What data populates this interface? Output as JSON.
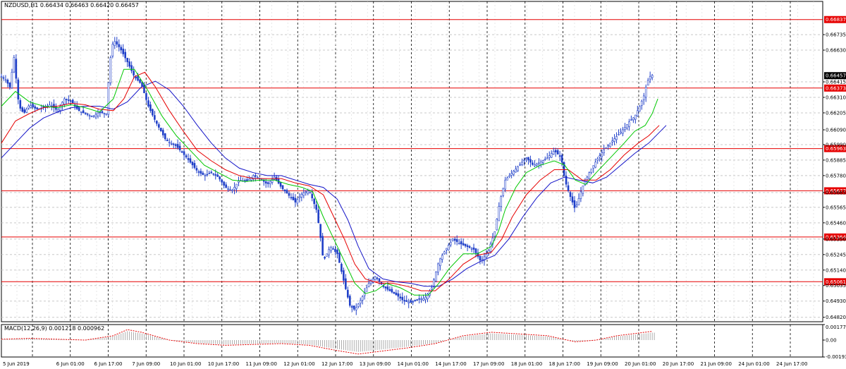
{
  "header": {
    "title": "NZDUSD,H1 0.66434 0.66463 0.66420 0.66457"
  },
  "indicator": {
    "label": "MACD(12,26,9) 0.001218 0.000962"
  },
  "colors": {
    "candle": "#1f3fc8",
    "ma_fast": "#00c800",
    "ma_mid": "#e60000",
    "ma_slow": "#1414c8",
    "level_line": "#e60000",
    "current_price_bg": "#000000"
  },
  "chart_data": [
    {
      "type": "candlestick",
      "symbol": "NZDUSD",
      "timeframe": "H1",
      "grid": true,
      "y_ticks": [
        "0.66735",
        "0.66630",
        "0.66415",
        "0.66310",
        "0.66205",
        "0.66090",
        "0.65990",
        "0.65885",
        "0.65780",
        "0.65665",
        "0.65565",
        "0.65460",
        "0.65350",
        "0.65245",
        "0.65140",
        "0.65035",
        "0.64930",
        "0.64820"
      ],
      "current_price": "0.66457",
      "levels": [
        "0.66837",
        "0.66373",
        "0.65963",
        "0.65677",
        "0.65364",
        "0.65061"
      ],
      "x_ticks": [
        "5 Jun 2019",
        "6 Jun 01:00",
        "6 Jun 17:00",
        "7 Jun 09:00",
        "10 Jun 01:00",
        "10 Jun 17:00",
        "11 Jun 09:00",
        "12 Jun 01:00",
        "12 Jun 17:00",
        "13 Jun 09:00",
        "14 Jun 01:00",
        "14 Jun 17:00",
        "17 Jun 09:00",
        "18 Jun 01:00",
        "18 Jun 17:00",
        "19 Jun 09:00",
        "20 Jun 01:00",
        "20 Jun 17:00",
        "21 Jun 09:00",
        "24 Jun 01:00",
        "24 Jun 17:00"
      ],
      "ylim": [
        0.6479,
        0.6696
      ],
      "close_path": [
        [
          0,
          0.6645
        ],
        [
          6,
          0.6643
        ],
        [
          12,
          0.6638
        ],
        [
          18,
          0.6658
        ],
        [
          25,
          0.6625
        ],
        [
          32,
          0.662
        ],
        [
          40,
          0.6626
        ],
        [
          50,
          0.6623
        ],
        [
          60,
          0.6624
        ],
        [
          70,
          0.6626
        ],
        [
          80,
          0.6622
        ],
        [
          90,
          0.663
        ],
        [
          100,
          0.6628
        ],
        [
          110,
          0.6622
        ],
        [
          120,
          0.662
        ],
        [
          130,
          0.6618
        ],
        [
          140,
          0.6621
        ],
        [
          150,
          0.662
        ],
        [
          155,
          0.6655
        ],
        [
          160,
          0.667
        ],
        [
          170,
          0.6664
        ],
        [
          180,
          0.6655
        ],
        [
          190,
          0.6645
        ],
        [
          200,
          0.664
        ],
        [
          210,
          0.6625
        ],
        [
          220,
          0.6615
        ],
        [
          235,
          0.6602
        ],
        [
          250,
          0.6598
        ],
        [
          265,
          0.659
        ],
        [
          280,
          0.6581
        ],
        [
          290,
          0.6578
        ],
        [
          300,
          0.658
        ],
        [
          310,
          0.6577
        ],
        [
          320,
          0.657
        ],
        [
          330,
          0.6568
        ],
        [
          340,
          0.6575
        ],
        [
          350,
          0.6574
        ],
        [
          360,
          0.6578
        ],
        [
          370,
          0.6576
        ],
        [
          380,
          0.6572
        ],
        [
          390,
          0.6577
        ],
        [
          400,
          0.657
        ],
        [
          410,
          0.6565
        ],
        [
          420,
          0.656
        ],
        [
          430,
          0.6566
        ],
        [
          440,
          0.6568
        ],
        [
          450,
          0.6555
        ],
        [
          455,
          0.654
        ],
        [
          460,
          0.652
        ],
        [
          470,
          0.653
        ],
        [
          480,
          0.6525
        ],
        [
          490,
          0.6505
        ],
        [
          498,
          0.649
        ],
        [
          505,
          0.6487
        ],
        [
          515,
          0.6495
        ],
        [
          525,
          0.6505
        ],
        [
          535,
          0.651
        ],
        [
          545,
          0.6503
        ],
        [
          555,
          0.65
        ],
        [
          565,
          0.6497
        ],
        [
          575,
          0.6493
        ],
        [
          585,
          0.6492
        ],
        [
          595,
          0.6494
        ],
        [
          605,
          0.6495
        ],
        [
          615,
          0.6502
        ],
        [
          625,
          0.652
        ],
        [
          635,
          0.6528
        ],
        [
          645,
          0.6535
        ],
        [
          655,
          0.6532
        ],
        [
          665,
          0.653
        ],
        [
          675,
          0.6528
        ],
        [
          685,
          0.652
        ],
        [
          695,
          0.6526
        ],
        [
          705,
          0.654
        ],
        [
          712,
          0.656
        ],
        [
          720,
          0.6575
        ],
        [
          730,
          0.658
        ],
        [
          740,
          0.6585
        ],
        [
          750,
          0.659
        ],
        [
          760,
          0.6585
        ],
        [
          770,
          0.6587
        ],
        [
          780,
          0.659
        ],
        [
          790,
          0.6595
        ],
        [
          800,
          0.659
        ],
        [
          805,
          0.6575
        ],
        [
          812,
          0.6565
        ],
        [
          820,
          0.6555
        ],
        [
          830,
          0.657
        ],
        [
          840,
          0.658
        ],
        [
          850,
          0.6588
        ],
        [
          860,
          0.6595
        ],
        [
          870,
          0.66
        ],
        [
          880,
          0.6605
        ],
        [
          890,
          0.661
        ],
        [
          898,
          0.6615
        ],
        [
          905,
          0.6618
        ],
        [
          912,
          0.6625
        ],
        [
          918,
          0.6632
        ],
        [
          922,
          0.664
        ],
        [
          926,
          0.6645
        ],
        [
          930,
          0.6646
        ]
      ],
      "ma_fast_path": [
        [
          0,
          0.6625
        ],
        [
          20,
          0.6635
        ],
        [
          40,
          0.6628
        ],
        [
          60,
          0.6625
        ],
        [
          80,
          0.6624
        ],
        [
          100,
          0.6626
        ],
        [
          120,
          0.6624
        ],
        [
          140,
          0.6621
        ],
        [
          160,
          0.663
        ],
        [
          175,
          0.665
        ],
        [
          190,
          0.665
        ],
        [
          210,
          0.6635
        ],
        [
          230,
          0.6618
        ],
        [
          250,
          0.6605
        ],
        [
          270,
          0.6595
        ],
        [
          290,
          0.6585
        ],
        [
          310,
          0.658
        ],
        [
          330,
          0.6575
        ],
        [
          350,
          0.6574
        ],
        [
          370,
          0.6575
        ],
        [
          390,
          0.6575
        ],
        [
          410,
          0.6572
        ],
        [
          430,
          0.657
        ],
        [
          445,
          0.6567
        ],
        [
          460,
          0.655
        ],
        [
          475,
          0.6535
        ],
        [
          490,
          0.652
        ],
        [
          505,
          0.6505
        ],
        [
          520,
          0.6498
        ],
        [
          535,
          0.65
        ],
        [
          550,
          0.6505
        ],
        [
          570,
          0.6502
        ],
        [
          590,
          0.6497
        ],
        [
          610,
          0.6497
        ],
        [
          625,
          0.6505
        ],
        [
          640,
          0.6515
        ],
        [
          660,
          0.6525
        ],
        [
          680,
          0.6525
        ],
        [
          700,
          0.653
        ],
        [
          710,
          0.654
        ],
        [
          720,
          0.6555
        ],
        [
          735,
          0.657
        ],
        [
          750,
          0.658
        ],
        [
          770,
          0.6585
        ],
        [
          790,
          0.6588
        ],
        [
          805,
          0.6585
        ],
        [
          820,
          0.6575
        ],
        [
          835,
          0.6572
        ],
        [
          850,
          0.658
        ],
        [
          870,
          0.659
        ],
        [
          890,
          0.66
        ],
        [
          905,
          0.6608
        ],
        [
          920,
          0.6612
        ],
        [
          930,
          0.662
        ],
        [
          938,
          0.663
        ]
      ],
      "ma_mid_path": [
        [
          0,
          0.66
        ],
        [
          20,
          0.6615
        ],
        [
          40,
          0.662
        ],
        [
          60,
          0.6624
        ],
        [
          80,
          0.6625
        ],
        [
          100,
          0.6627
        ],
        [
          120,
          0.6626
        ],
        [
          140,
          0.6623
        ],
        [
          160,
          0.6622
        ],
        [
          175,
          0.663
        ],
        [
          190,
          0.6645
        ],
        [
          205,
          0.6648
        ],
        [
          220,
          0.6638
        ],
        [
          240,
          0.6622
        ],
        [
          260,
          0.6608
        ],
        [
          280,
          0.6595
        ],
        [
          300,
          0.6588
        ],
        [
          320,
          0.6582
        ],
        [
          340,
          0.6578
        ],
        [
          360,
          0.6576
        ],
        [
          380,
          0.6576
        ],
        [
          400,
          0.6576
        ],
        [
          420,
          0.6573
        ],
        [
          440,
          0.6571
        ],
        [
          460,
          0.6565
        ],
        [
          475,
          0.655
        ],
        [
          490,
          0.6535
        ],
        [
          505,
          0.6518
        ],
        [
          520,
          0.6508
        ],
        [
          540,
          0.6505
        ],
        [
          560,
          0.6505
        ],
        [
          580,
          0.6503
        ],
        [
          600,
          0.65
        ],
        [
          620,
          0.65
        ],
        [
          640,
          0.6508
        ],
        [
          660,
          0.6518
        ],
        [
          680,
          0.6524
        ],
        [
          700,
          0.6526
        ],
        [
          715,
          0.6535
        ],
        [
          730,
          0.655
        ],
        [
          750,
          0.6565
        ],
        [
          770,
          0.6575
        ],
        [
          790,
          0.6582
        ],
        [
          810,
          0.6582
        ],
        [
          830,
          0.6575
        ],
        [
          850,
          0.6575
        ],
        [
          870,
          0.6582
        ],
        [
          890,
          0.6592
        ],
        [
          910,
          0.66
        ],
        [
          925,
          0.6605
        ],
        [
          940,
          0.6612
        ]
      ],
      "ma_slow_path": [
        [
          0,
          0.659
        ],
        [
          20,
          0.66
        ],
        [
          40,
          0.661
        ],
        [
          60,
          0.6617
        ],
        [
          80,
          0.6621
        ],
        [
          100,
          0.6624
        ],
        [
          120,
          0.6625
        ],
        [
          140,
          0.6625
        ],
        [
          160,
          0.6623
        ],
        [
          180,
          0.6628
        ],
        [
          200,
          0.6638
        ],
        [
          220,
          0.6642
        ],
        [
          240,
          0.6636
        ],
        [
          260,
          0.6625
        ],
        [
          280,
          0.6612
        ],
        [
          300,
          0.66
        ],
        [
          320,
          0.659
        ],
        [
          340,
          0.6583
        ],
        [
          360,
          0.658
        ],
        [
          380,
          0.6578
        ],
        [
          400,
          0.6578
        ],
        [
          420,
          0.6575
        ],
        [
          440,
          0.6572
        ],
        [
          460,
          0.657
        ],
        [
          480,
          0.6562
        ],
        [
          495,
          0.6548
        ],
        [
          510,
          0.653
        ],
        [
          525,
          0.6515
        ],
        [
          545,
          0.6508
        ],
        [
          565,
          0.6506
        ],
        [
          585,
          0.6505
        ],
        [
          605,
          0.6503
        ],
        [
          625,
          0.6503
        ],
        [
          645,
          0.6508
        ],
        [
          665,
          0.6515
        ],
        [
          685,
          0.652
        ],
        [
          705,
          0.6524
        ],
        [
          725,
          0.6535
        ],
        [
          745,
          0.655
        ],
        [
          765,
          0.6563
        ],
        [
          785,
          0.6573
        ],
        [
          805,
          0.6577
        ],
        [
          825,
          0.6575
        ],
        [
          845,
          0.6573
        ],
        [
          865,
          0.6577
        ],
        [
          885,
          0.6585
        ],
        [
          905,
          0.6593
        ],
        [
          925,
          0.66
        ],
        [
          950,
          0.6612
        ]
      ]
    },
    {
      "type": "bar",
      "name": "MACD(12,26,9)",
      "y_ticks": [
        "0.001779",
        "0.00",
        "-0.001939"
      ],
      "ylim": [
        -0.001939,
        0.001779
      ],
      "signal_path": [
        [
          0,
          0.0001
        ],
        [
          40,
          0.0002
        ],
        [
          80,
          0.0001
        ],
        [
          120,
          0.0
        ],
        [
          160,
          0.0005
        ],
        [
          180,
          0.0012
        ],
        [
          200,
          0.0009
        ],
        [
          240,
          0.0
        ],
        [
          280,
          -0.0004
        ],
        [
          320,
          -0.0006
        ],
        [
          360,
          -0.0005
        ],
        [
          400,
          -0.0004
        ],
        [
          440,
          -0.0006
        ],
        [
          480,
          -0.0012
        ],
        [
          510,
          -0.0016
        ],
        [
          540,
          -0.0013
        ],
        [
          580,
          -0.0009
        ],
        [
          620,
          -0.0004
        ],
        [
          660,
          0.0005
        ],
        [
          700,
          0.0009
        ],
        [
          740,
          0.0007
        ],
        [
          780,
          0.0005
        ],
        [
          820,
          -0.0002
        ],
        [
          850,
          0.0
        ],
        [
          880,
          0.0005
        ],
        [
          910,
          0.0008
        ],
        [
          930,
          0.001
        ]
      ]
    }
  ]
}
